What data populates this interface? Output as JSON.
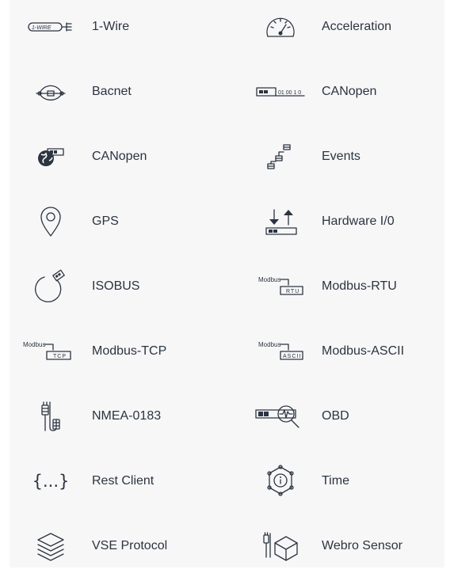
{
  "protocols": {
    "items": [
      {
        "label": "1-Wire",
        "icon": "one-wire-icon"
      },
      {
        "label": "Acceleration",
        "icon": "gauge-icon"
      },
      {
        "label": "Bacnet",
        "icon": "network-node-icon"
      },
      {
        "label": "CANopen",
        "icon": "can-bus-icon"
      },
      {
        "label": "CANopen",
        "icon": "globe-device-icon"
      },
      {
        "label": "Events",
        "icon": "events-flow-icon"
      },
      {
        "label": "GPS",
        "icon": "map-pin-icon"
      },
      {
        "label": "Hardware I/0",
        "icon": "io-arrows-icon"
      },
      {
        "label": "ISOBUS",
        "icon": "isobus-cable-icon"
      },
      {
        "label": "Modbus-RTU",
        "icon": "modbus-rtu-icon"
      },
      {
        "label": "Modbus-TCP",
        "icon": "modbus-tcp-icon"
      },
      {
        "label": "Modbus-ASCII",
        "icon": "modbus-ascii-icon"
      },
      {
        "label": "NMEA-0183",
        "icon": "connector-cable-icon"
      },
      {
        "label": "OBD",
        "icon": "obd-magnifier-icon"
      },
      {
        "label": "Rest Client",
        "icon": "braces-icon"
      },
      {
        "label": "Time",
        "icon": "time-network-icon"
      },
      {
        "label": "VSE Protocol",
        "icon": "layers-icon"
      },
      {
        "label": "Webro Sensor",
        "icon": "sensor-cube-icon"
      }
    ],
    "icon_text": {
      "one_wire": "1-WIRE",
      "modbus": "Modbus",
      "rtu": "RTU",
      "tcp": "TCP",
      "ascii": "ASCII",
      "can_bits": "01 00 1 0",
      "braces": "{...}"
    }
  }
}
